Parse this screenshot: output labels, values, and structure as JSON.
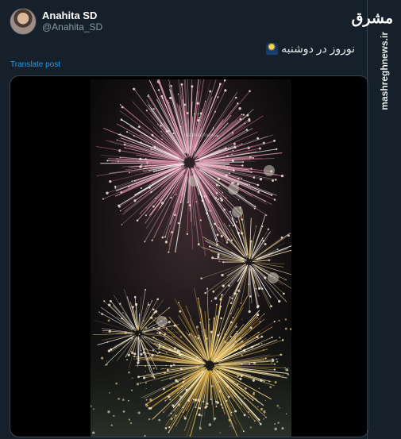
{
  "tweet": {
    "display_name": "Anahita SD",
    "handle": "@Anahita_SD",
    "text": "نوروز در دوشنبه",
    "translate_label": "Translate post"
  },
  "media": {
    "icons": [
      "fireworks-video",
      "sunrise-sparkle-icon"
    ],
    "watermark": "mashreghnews"
  },
  "brand": {
    "logo_text": "مشرق",
    "url": "mashreghnews.ir"
  },
  "colors": {
    "background": "#15202b",
    "link": "#1d9bf0",
    "secondary_text": "#8b98a5"
  }
}
